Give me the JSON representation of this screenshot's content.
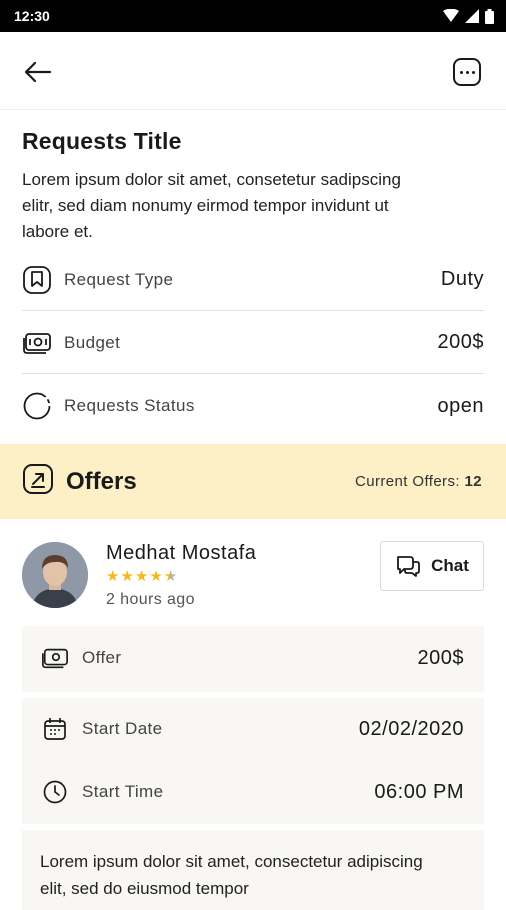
{
  "status_bar": {
    "time": "12:30"
  },
  "request": {
    "title": "Requests Title",
    "description": "Lorem ipsum dolor sit amet, consetetur sadipscing elitr, sed diam nonumy eirmod tempor invidunt ut labore et.",
    "details": [
      {
        "label": "Request Type",
        "value": "Duty",
        "icon": "bookmark-icon"
      },
      {
        "label": "Budget",
        "value": "200$",
        "icon": "money-icon"
      },
      {
        "label": "Requests Status",
        "value": "open",
        "icon": "status-circle-icon"
      }
    ]
  },
  "offers": {
    "title": "Offers",
    "count_label": "Current Offers:",
    "count": "12",
    "accent_color": "#fdefc6"
  },
  "offer": {
    "user_name": "Medhat Mostafa",
    "rating": 4.5,
    "rating_max": 5,
    "time_ago": "2 hours ago",
    "chat_label": "Chat",
    "amount_label": "Offer",
    "amount_value": "200$",
    "start_date_label": "Start Date",
    "start_date_value": "02/02/2020",
    "start_time_label": "Start Time",
    "start_time_value": "06:00 PM",
    "note": "Lorem ipsum dolor sit amet, consectetur adipiscing elit, sed do eiusmod tempor"
  }
}
